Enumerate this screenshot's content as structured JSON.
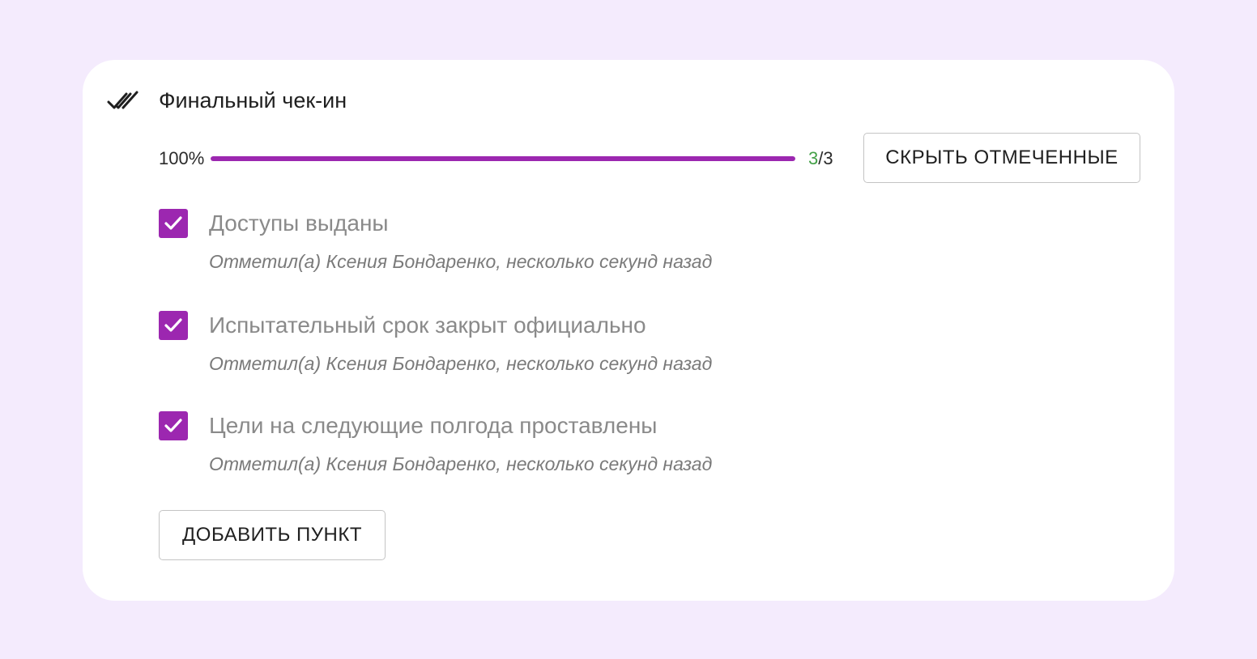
{
  "checklist": {
    "title": "Финальный чек-ин",
    "header_icon": "double-check-icon",
    "accent_color": "#9c27b0",
    "progress": {
      "percent_label": "100%",
      "percent": 100,
      "done": "3",
      "separator": "/",
      "total": "3"
    },
    "hide_button_label": "СКРЫТЬ ОТМЕЧЕННЫЕ",
    "add_button_label": "ДОБАВИТЬ ПУНКТ",
    "items": [
      {
        "label": "Доступы выданы",
        "checked": true,
        "meta": "Отметил(а) Ксения Бондаренко, несколько секунд назад"
      },
      {
        "label": "Испытательный срок закрыт официально",
        "checked": true,
        "meta": "Отметил(а) Ксения Бондаренко, несколько секунд назад"
      },
      {
        "label": "Цели на следующие полгода проставлены",
        "checked": true,
        "meta": "Отметил(а) Ксения Бондаренко, несколько секунд назад"
      }
    ]
  }
}
